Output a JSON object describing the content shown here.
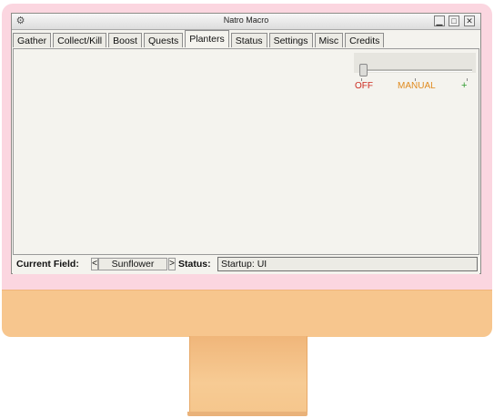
{
  "window": {
    "title": "Natro Macro",
    "icon": "gear-icon",
    "controls": {
      "minimize": "▁",
      "maximize": "□",
      "close": "✕"
    }
  },
  "tabs": [
    {
      "label": "Gather",
      "active": false
    },
    {
      "label": "Collect/Kill",
      "active": false
    },
    {
      "label": "Boost",
      "active": false
    },
    {
      "label": "Quests",
      "active": false
    },
    {
      "label": "Planters",
      "active": true
    },
    {
      "label": "Status",
      "active": false
    },
    {
      "label": "Settings",
      "active": false
    },
    {
      "label": "Misc",
      "active": false
    },
    {
      "label": "Credits",
      "active": false
    }
  ],
  "planter_mode_slider": {
    "value": 0,
    "labels": {
      "off": "OFF",
      "manual": "MANUAL",
      "plus": "+"
    },
    "colors": {
      "off": "#cc2b20",
      "manual": "#e08a1e",
      "plus": "#2f9b2f"
    }
  },
  "statusbar": {
    "field_label": "Current Field:",
    "prev_arrow": "<",
    "field_value": "Sunflower",
    "next_arrow": ">",
    "status_label": "Status:",
    "status_value": "Startup: UI"
  }
}
